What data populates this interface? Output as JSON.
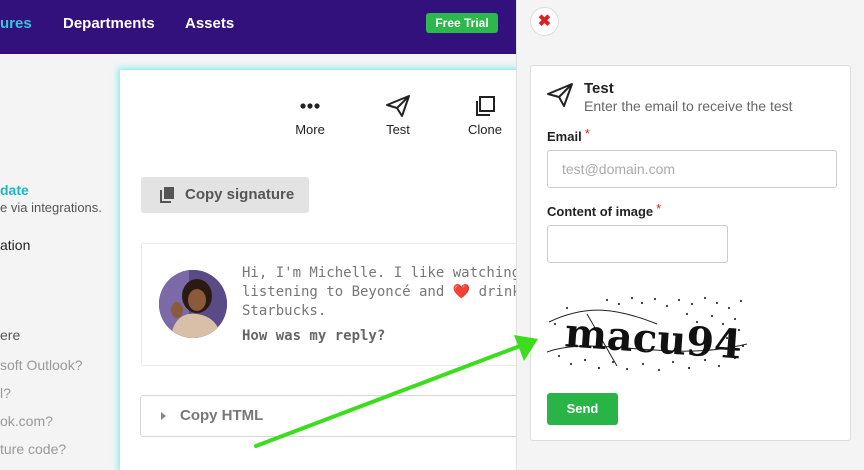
{
  "topnav": {
    "items": [
      "ures",
      "Departments",
      "Assets"
    ],
    "trial_label": "Free Trial"
  },
  "sidebar": {
    "lines": [
      "date",
      "e via integrations.",
      "ation",
      "ere",
      "soft Outlook?",
      "l?",
      "ok.com?",
      "ture code?"
    ]
  },
  "toolbar": {
    "more_label": "More",
    "test_label": "Test",
    "clone_label": "Clone"
  },
  "signature": {
    "copy_label": "Copy signature",
    "text_lines": [
      "Hi, I'm Michelle. I like watching Star W",
      "listening to Beyoncé and ❤️ drinking co",
      "Starbucks."
    ],
    "question": "How was my reply?",
    "copy_html_label": "Copy HTML"
  },
  "test_panel": {
    "title": "Test",
    "subtitle": "Enter the email to receive the test",
    "email_label": "Email",
    "email_placeholder": "test@domain.com",
    "image_label": "Content of image",
    "image_value": "",
    "required_mark": "*",
    "captcha_text": "macu94",
    "send_label": "Send",
    "close_icon": "close-icon"
  },
  "colors": {
    "nav_bg": "#33117d",
    "accent": "#34c6d6",
    "green": "#28b446",
    "arrow": "#3ddc1f"
  }
}
